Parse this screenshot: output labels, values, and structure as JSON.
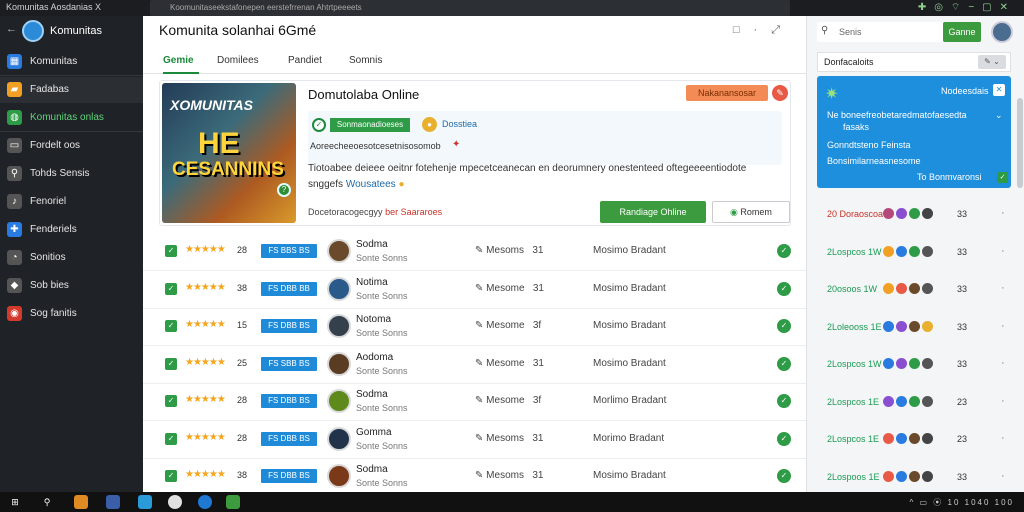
{
  "topbar": {
    "app_name": "Komunitas Aosdanias X",
    "search_text": "Koomunitaseekstafonepen eerstefrrenan Ahtrtpeeeets",
    "tray_icons": [
      "puzzle-icon",
      "bell-icon",
      "wifi-icon",
      "dash-icon",
      "square-icon",
      "close-icon"
    ]
  },
  "sidebar": {
    "back": "←",
    "title": "Komunitas",
    "items": [
      {
        "icon": "grid-icon",
        "label": "Komunitas",
        "color": "#2a7be0"
      },
      {
        "icon": "folder-icon",
        "label": "Fadabas",
        "color": "#f2a024",
        "active": true
      },
      {
        "icon": "globe-icon",
        "label": "Komunitas onlas",
        "color": "#2e9b46",
        "green": true
      },
      {
        "icon": "monitor-icon",
        "label": "Fordelt oos",
        "color": "#555"
      },
      {
        "icon": "search-icon",
        "label": "Tohds Sensis",
        "color": "#555"
      },
      {
        "icon": "bell-icon",
        "label": "Fenoriel",
        "color": "#555"
      },
      {
        "icon": "puzzle-icon",
        "label": "Fenderiels",
        "color": "#2a7be0"
      },
      {
        "icon": "magnifier-icon",
        "label": "Sonitios",
        "color": "#555"
      },
      {
        "icon": "tag-icon",
        "label": "Sob bies",
        "color": "#555"
      },
      {
        "icon": "record-icon",
        "label": "Sog fanitis",
        "color": "#d33a2c"
      }
    ]
  },
  "main": {
    "title": "Komunita solanhai 6Gmé",
    "window_controls": [
      "□",
      "·",
      "⤢"
    ],
    "tabs": [
      "Gemie",
      "Domilees",
      "Pandiet",
      "Somnis"
    ],
    "featured": {
      "cover_text_1": "XOMUNITAS",
      "cover_text_2": "HE",
      "cover_text_3": "CESANNINS",
      "title": "Domutolaba Online",
      "report_button": "Nakanansosar",
      "close_glyph": "✎",
      "tag": "Sonmaonadioeses",
      "coin_label": "Dosstiea",
      "subline": "Aoreecheeoesotcesetnisosomob",
      "description": "Tiotoabee deieee oeitnr fotehenje mpecetceanecan en deorumnery onestenteed oftegeeeentiodote",
      "desc_line2_a": "snggefs",
      "desc_line2_hl": "Wousatees",
      "meta_a": "Docetoracogecgyy",
      "meta_red": "ber Saararoes",
      "primary_button": "Randiage Ohline",
      "secondary_button": "Romem"
    },
    "rows": [
      {
        "stars": "★★★★★",
        "rating": "28",
        "tag": "FS BBS BS",
        "name": "Sodma",
        "sub": "Sonte Sonns",
        "meas": "Mesoms",
        "meas_n": "31",
        "status": "Mosimo Bradant",
        "avatar": "#6a4a2a"
      },
      {
        "stars": "★★★★★",
        "rating": "38",
        "tag": "FS DBB BB",
        "name": "Notima",
        "sub": "Sonte Sonns",
        "meas": "Mesome",
        "meas_n": "31",
        "status": "Mosimo Bradant",
        "avatar": "#2a5a8a"
      },
      {
        "stars": "★★★★★",
        "rating": "15",
        "tag": "FS DBB BS",
        "name": "Notoma",
        "sub": "Sonte Sonns",
        "meas": "Mesome",
        "meas_n": "3f",
        "status": "Mosimo Bradant",
        "avatar": "#34404c"
      },
      {
        "stars": "★★★★★",
        "rating": "25",
        "tag": "FS SBB BS",
        "name": "Aodoma",
        "sub": "Sonte Sonns",
        "meas": "Mesome",
        "meas_n": "31",
        "status": "Mosimo Bradant",
        "avatar": "#5a3c22"
      },
      {
        "stars": "★★★★★",
        "rating": "28",
        "tag": "FS DBB BS",
        "name": "Sodma",
        "sub": "Sonte Sonns",
        "meas": "Mesome",
        "meas_n": "3f",
        "status": "Morlimo Bradant",
        "avatar": "#5e8a1c"
      },
      {
        "stars": "★★★★★",
        "rating": "28",
        "tag": "FS DBB BS",
        "name": "Gomma",
        "sub": "Sonte Sonns",
        "meas": "Mesoms",
        "meas_n": "31",
        "status": "Morimo Bradant",
        "avatar": "#22324a"
      },
      {
        "stars": "★★★★★",
        "rating": "38",
        "tag": "FS DBB BS",
        "name": "Sodma",
        "sub": "Sonte Sonns",
        "meas": "Mesoms",
        "meas_n": "31",
        "status": "Mosimo Bradant",
        "avatar": "#7a3a1a"
      }
    ]
  },
  "right": {
    "search_placeholder": "Senis",
    "search_button": "Ganne",
    "card_header": "Donfacaloits",
    "card_header_chip": "✎ ⌄",
    "card": {
      "head": "Nodeesdais",
      "line1": "Ne boneefreobetaredmatofaesedta",
      "line1b": "fasaks",
      "line2": "Gonndtsteno Feinsta",
      "line3": "Bonsimilarneasnesome",
      "footer": "To Bonmvaronsi"
    },
    "rows": [
      {
        "text": "20 Doraoscoa",
        "n": "33",
        "red": true,
        "dots": [
          "#b34a7a",
          "#8a4fd0",
          "#2e9b46",
          "#444"
        ]
      },
      {
        "text": "2Lospcos 1W",
        "n": "33",
        "dots": [
          "#f2a024",
          "#2a7be0",
          "#2e9b46",
          "#555"
        ]
      },
      {
        "text": "20osoos 1W",
        "n": "33",
        "dots": [
          "#f2a024",
          "#e85a45",
          "#6a4a2a",
          "#555"
        ]
      },
      {
        "text": "2Loleooss 1E",
        "n": "33",
        "dots": [
          "#2a7be0",
          "#8a4fd0",
          "#6a4a2a",
          "#e8b02e"
        ]
      },
      {
        "text": "2Lospcos 1W",
        "n": "33",
        "dots": [
          "#2a7be0",
          "#8a4fd0",
          "#2e9b46",
          "#555"
        ]
      },
      {
        "text": "2Lospcos 1E",
        "n": "23",
        "dots": [
          "#8a4fd0",
          "#2a7be0",
          "#2e9b46",
          "#555"
        ]
      },
      {
        "text": "2Lospcos 1E",
        "n": "23",
        "dots": [
          "#e85a45",
          "#2a7be0",
          "#6a4a2a",
          "#444"
        ]
      },
      {
        "text": "2Lospoos 1E",
        "n": "33",
        "dots": [
          "#e85a45",
          "#2a7be0",
          "#6a4a2a",
          "#444"
        ]
      },
      {
        "text": "2Lospcos 1W",
        "n": "33",
        "dots": [
          "#2a7be0",
          "#8a4fd0",
          "#2e9b46",
          "#444"
        ]
      }
    ]
  },
  "taskbar": {
    "tray_text": "^ ▭ ⦿ 10 1040 100"
  }
}
